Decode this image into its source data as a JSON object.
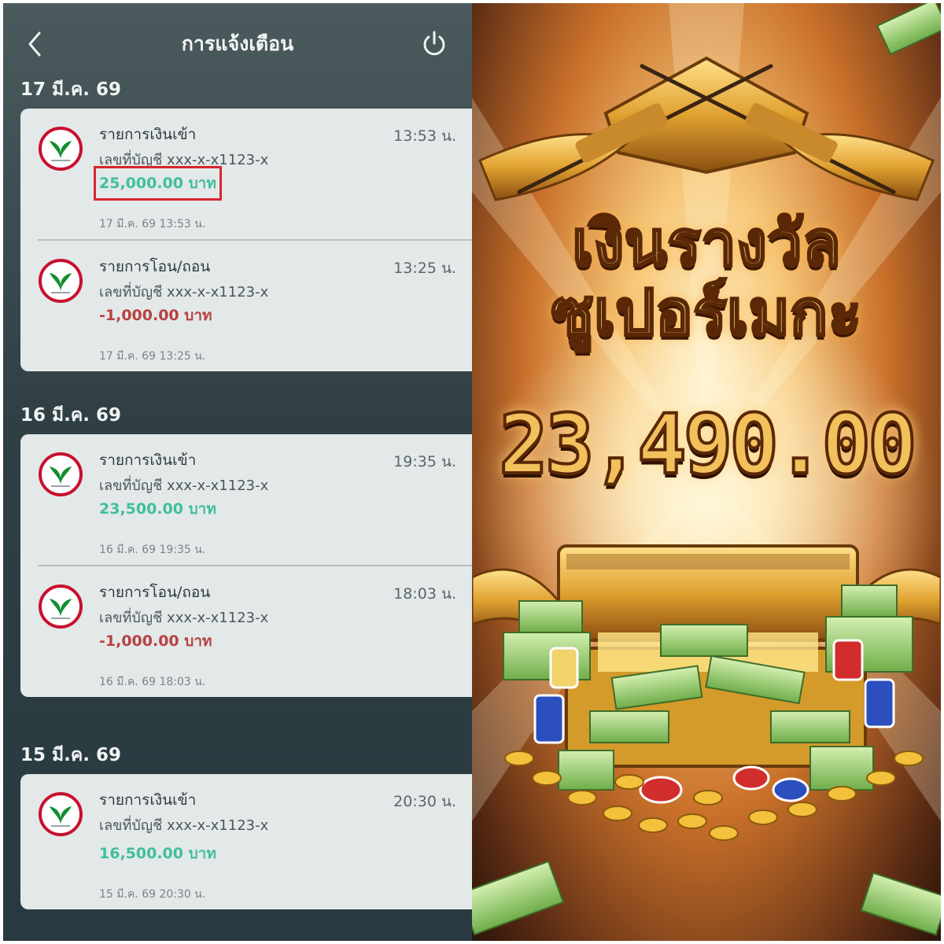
{
  "header": {
    "title": "การแจ้งเตือน",
    "back_icon": "chevron-left-icon",
    "power_icon": "power-icon"
  },
  "groups": [
    {
      "date": "17 มี.ค. 69",
      "items": [
        {
          "title": "รายการเงินเข้า",
          "time": "13:53 น.",
          "account": "เลขที่บัญชี xxx-x-x1123-x",
          "amount": "25,000.00 บาท",
          "type": "in",
          "stamp": "17 มี.ค. 69 13:53 น."
        },
        {
          "title": "รายการโอน/ถอน",
          "time": "13:25 น.",
          "account": "เลขที่บัญชี xxx-x-x1123-x",
          "amount": "-1,000.00 บาท",
          "type": "out",
          "stamp": "17 มี.ค. 69 13:25 น."
        }
      ]
    },
    {
      "date": "16 มี.ค. 69",
      "items": [
        {
          "title": "รายการเงินเข้า",
          "time": "19:35 น.",
          "account": "เลขที่บัญชี xxx-x-x1123-x",
          "amount": "23,500.00 บาท",
          "type": "in",
          "stamp": "16 มี.ค. 69 19:35 น."
        },
        {
          "title": "รายการโอน/ถอน",
          "time": "18:03 น.",
          "account": "เลขที่บัญชี xxx-x-x1123-x",
          "amount": "-1,000.00 บาท",
          "type": "out",
          "stamp": "16 มี.ค. 69 18:03 น."
        }
      ]
    },
    {
      "date": "15 มี.ค. 69",
      "items": [
        {
          "title": "รายการเงินเข้า",
          "time": "20:30 น.",
          "account": "เลขที่บัญชี xxx-x-x1123-x",
          "amount": "16,500.00 บาท",
          "type": "in",
          "stamp": "15 มี.ค. 69 20:30 น."
        }
      ]
    }
  ],
  "colors": {
    "income": "#3fbf9e",
    "expense": "#b84141",
    "highlight_box": "#d8262c",
    "bank_green": "#138f2d",
    "bank_red": "#c8102e"
  },
  "promo": {
    "line1": "เงินรางวัล",
    "line2": "ซูเปอร์เมกะ",
    "amount": "23,490.00"
  }
}
